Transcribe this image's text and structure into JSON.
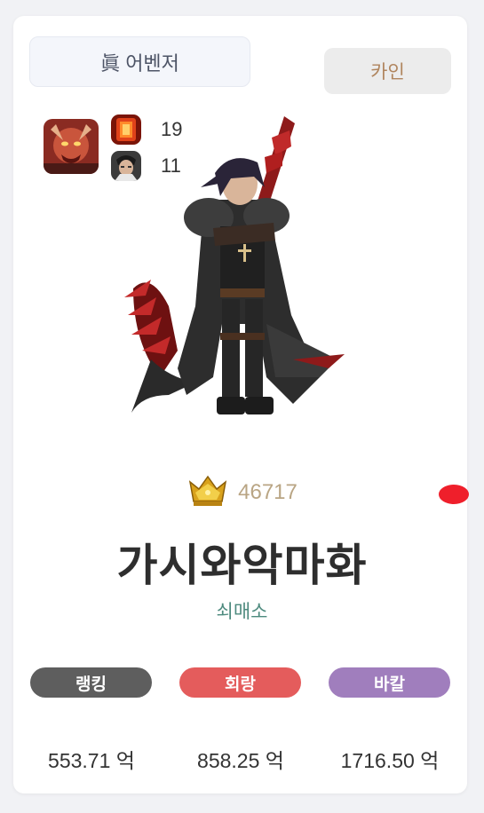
{
  "character": {
    "class_name": "眞 어벤저",
    "server": "카인",
    "name": "가시와악마화",
    "guild": "쇠매소",
    "fame": "46717"
  },
  "buffs": [
    {
      "icon": "red-buff-skill-icon",
      "value": "19"
    },
    {
      "icon": "creature-portrait-icon",
      "value": "11"
    }
  ],
  "badges": [
    {
      "label": "랭킹",
      "color": "#5e5e5e"
    },
    {
      "label": "회랑",
      "color": "#e45c5c"
    },
    {
      "label": "바칼",
      "color": "#a07ebd"
    }
  ],
  "stats": [
    {
      "value": "553.71 억"
    },
    {
      "value": "858.25 억"
    },
    {
      "value": "1716.50 억"
    }
  ],
  "colors": {
    "fame": "#b9a584",
    "guild": "#4d8a7e",
    "server": "#b0855e"
  }
}
